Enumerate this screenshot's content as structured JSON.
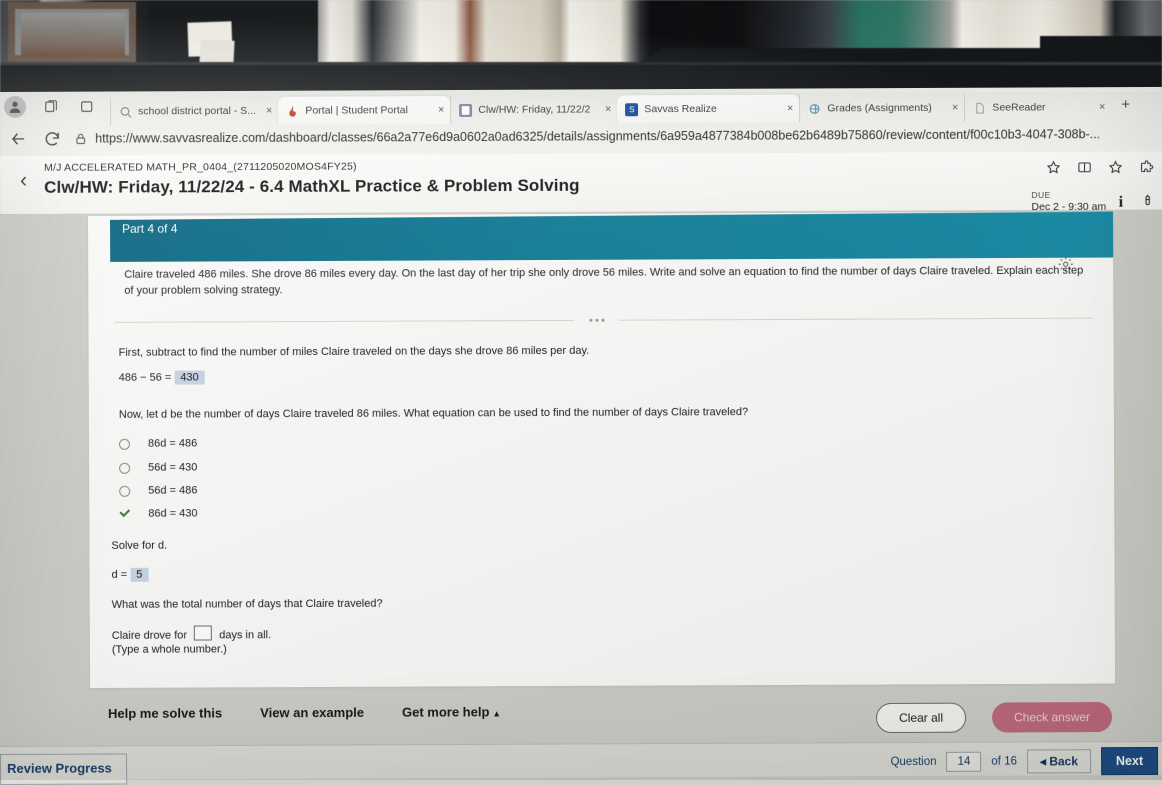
{
  "browser": {
    "tabs": [
      {
        "title": "school district portal - S...",
        "favicon": "search-icon",
        "color": "#8a8a8a",
        "active": false
      },
      {
        "title": "Portal | Student Portal",
        "favicon": "flame-icon",
        "color": "#c2452d",
        "active": true
      },
      {
        "title": "Clw/HW: Friday, 11/22/2",
        "favicon": "doc-icon",
        "color": "#5b6b8c",
        "active": false
      },
      {
        "title": "Savvas Realize",
        "favicon": "s-icon",
        "color": "#1a4fa0",
        "active": true
      },
      {
        "title": "Grades (Assignments)",
        "favicon": "globe-icon",
        "color": "#5aa9c9",
        "active": false
      },
      {
        "title": "SeeReader",
        "favicon": "page-icon",
        "color": "#bbbbbb",
        "active": false
      }
    ],
    "new_tab_label": "+",
    "close_label": "×",
    "url": "https://www.savvasrealize.com/dashboard/classes/66a2a77e6d9a0602a0ad6325/details/assignments/6a959a4877384b008be62b6489b75860/review/content/f00c10b3-4047-308b-...",
    "nav": {
      "back": "←",
      "reload": "↻",
      "lock": "lock-icon"
    }
  },
  "app_header": {
    "back_label": "‹",
    "course_code": "M/J ACCELERATED MATH_PR_0404_(2711205020MOS4FY25)",
    "assignment_title": "Clw/HW: Friday, 11/22/24 - 6.4 MathXL Practice & Problem Solving",
    "due_label": "DUE",
    "due_value": "Dec 2 - 9:30 am",
    "info_icon": "info-icon",
    "battery_icon": "battery-icon",
    "toolbar_icons": [
      "star-icon",
      "split-screen-icon",
      "favorite-icon",
      "extension-icon"
    ]
  },
  "exercise": {
    "part_label": "Part 4 of 4",
    "settings_icon": "gear-icon",
    "prompt": "Claire traveled 486 miles. She drove 86 miles every day. On the last day of her trip she only drove 56 miles. Write and solve an equation to find the number of days Claire traveled. Explain each step of your problem solving strategy.",
    "step1_text": "First, subtract to find the number of miles Claire traveled on the days she drove 86 miles per day.",
    "step1_equation_prefix": "486 − 56 =",
    "step1_answer": "430",
    "step2_text": "Now, let d be the number of days Claire traveled 86 miles. What equation can be used to find the number of days Claire traveled?",
    "options": [
      {
        "label": "86d = 486",
        "selected": false
      },
      {
        "label": "56d = 430",
        "selected": false
      },
      {
        "label": "56d = 486",
        "selected": false
      },
      {
        "label": "86d = 430",
        "selected": true
      }
    ],
    "step3_text": "Solve for d.",
    "step3_equation_prefix": "d =",
    "step3_answer": "5",
    "step4_question": "What was the total number of days that Claire traveled?",
    "final_prefix": "Claire drove for",
    "final_input_value": "",
    "final_suffix": "days in all.",
    "final_hint": "(Type a whole number.)"
  },
  "help": {
    "help_me_solve": "Help me solve this",
    "view_example": "View an example",
    "get_more_help": "Get more help",
    "caret": "▴"
  },
  "actions": {
    "clear_all": "Clear all",
    "check_answer": "Check answer"
  },
  "footer": {
    "review_progress": "Review Progress",
    "question_label": "Question",
    "question_number": "14",
    "of_label": "of 16",
    "back": "◂ Back",
    "next": "Next"
  },
  "colors": {
    "part_bar": "#147f99",
    "check_answer": "#c06b7e",
    "next_button": "#1f4e86",
    "answer_highlight": "#c9d6e6"
  }
}
